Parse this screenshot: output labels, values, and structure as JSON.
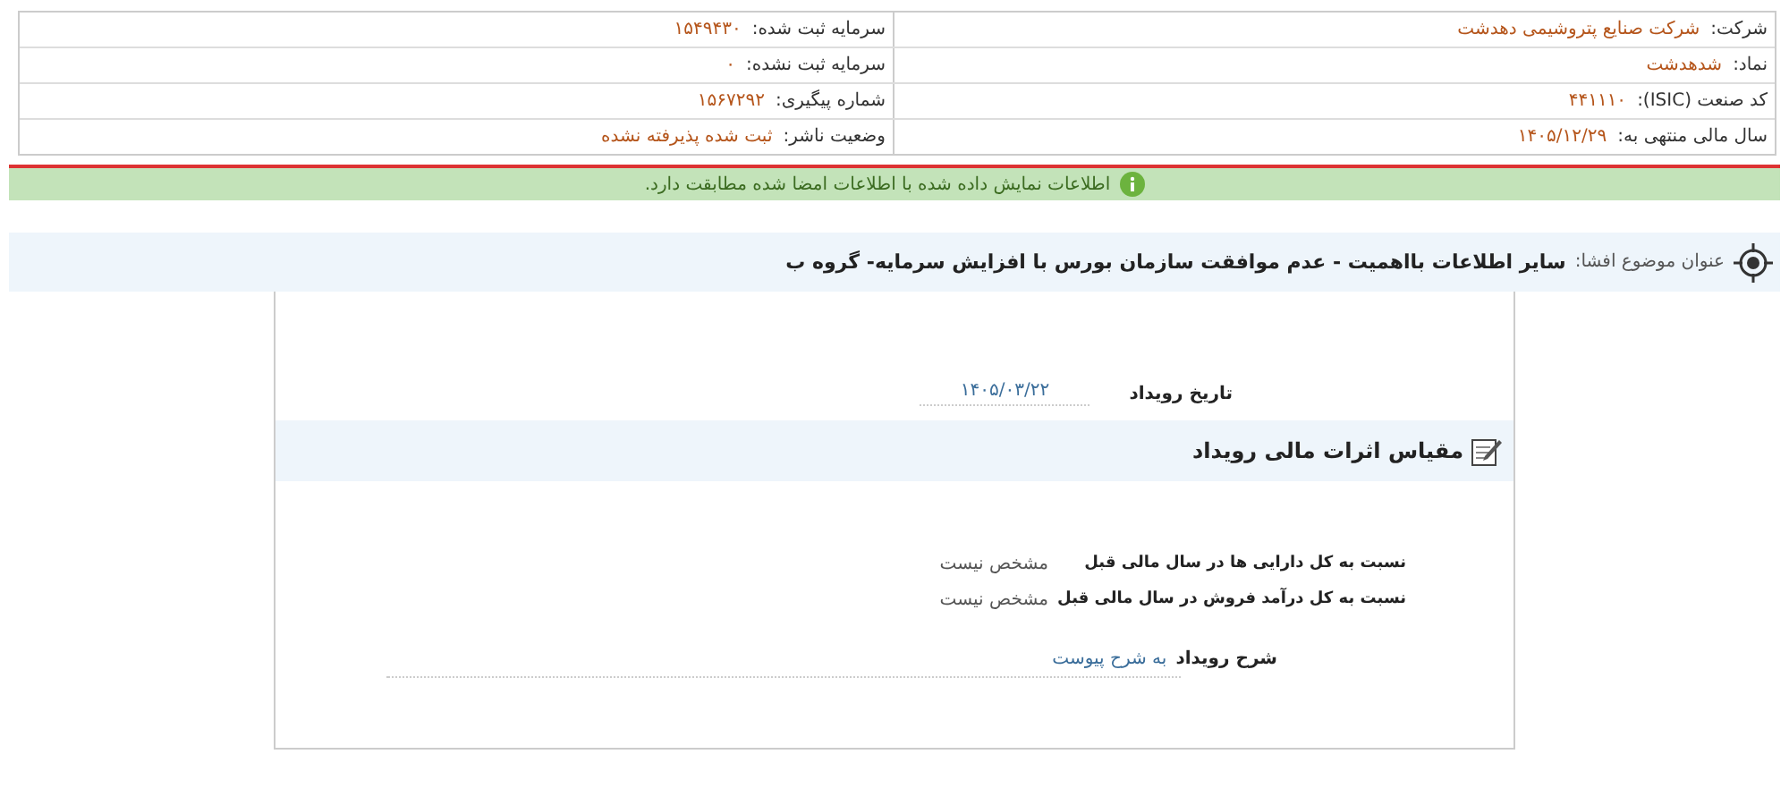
{
  "info_table": {
    "rows": [
      {
        "cells": [
          {
            "label": "شرکت:",
            "value": "شرکت صنایع پتروشیمی دهدشت"
          },
          {
            "label": "سرمایه ثبت شده:",
            "value": "۱۵۴۹۴۳۰"
          }
        ]
      },
      {
        "cells": [
          {
            "label": "نماد:",
            "value": "شدهدشت"
          },
          {
            "label": "سرمایه ثبت نشده:",
            "value": "۰"
          }
        ]
      },
      {
        "cells": [
          {
            "label": "کد صنعت (ISIC):",
            "value": "۴۴۱۱۱۰"
          },
          {
            "label": "شماره پیگیری:",
            "value": "۱۵۶۷۲۹۲"
          }
        ]
      },
      {
        "cells": [
          {
            "label": "سال مالی منتهی به:",
            "value": "۱۴۰۵/۱۲/۲۹"
          },
          {
            "label": "وضعیت ناشر:",
            "value": "ثبت شده پذیرفته نشده"
          }
        ]
      }
    ]
  },
  "notice": {
    "text": "اطلاعات نمایش داده شده با اطلاعات امضا شده مطابقت دارد."
  },
  "subject": {
    "label": "عنوان موضوع افشا:",
    "value": "سایر اطلاعات بااهمیت - عدم موافقت سازمان بورس با افزایش سرمایه- گروه ب"
  },
  "event_date": {
    "label": "تاریخ رویداد",
    "value": "۱۴۰۵/۰۳/۲۲"
  },
  "section": {
    "title": "مقیاس اثرات مالی رویداد"
  },
  "metrics": [
    {
      "label": "نسبت به کل دارایی ها در سال مالی قبل",
      "value": "مشخص نیست"
    },
    {
      "label": "نسبت به کل درآمد فروش در سال مالی قبل",
      "value": "مشخص نیست"
    }
  ],
  "description": {
    "label": "شرح رویداد",
    "value": "به شرح پیوست"
  }
}
